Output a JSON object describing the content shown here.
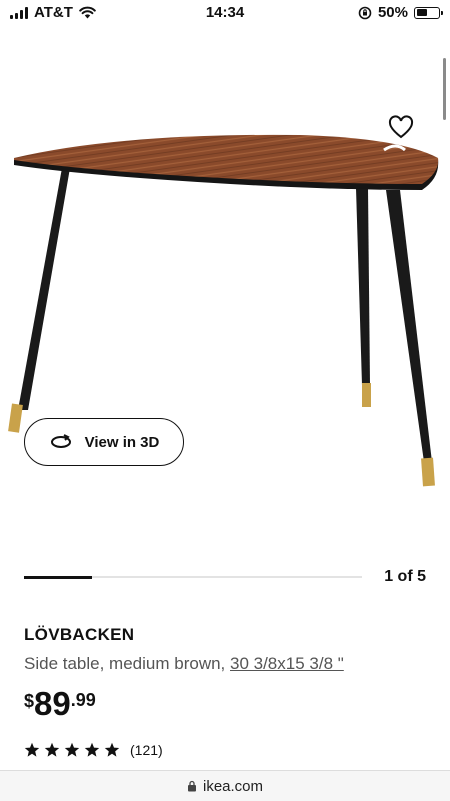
{
  "status_bar": {
    "carrier": "AT&T",
    "time": "14:34",
    "battery_percent": "50%",
    "battery_level": 0.5,
    "icons": [
      "signal-icon",
      "wifi-icon",
      "rotation-lock-icon",
      "battery-icon"
    ]
  },
  "product": {
    "favorite_icon": "heart-icon",
    "view_3d_label": "View in 3D",
    "view_3d_icon": "rotate-3d-icon",
    "carousel": {
      "counter": "1 of 5",
      "current": 1,
      "total": 5
    },
    "name": "LÖVBACKEN",
    "description": "Side table, medium brown, ",
    "dimensions": "30 3/8x15 3/8 \"",
    "price": {
      "currency": "$",
      "integer": "89",
      "decimal": ".99"
    },
    "rating": {
      "stars": 5,
      "count": "(121)"
    }
  },
  "browser": {
    "url": "ikea.com",
    "lock_icon": "lock-icon"
  },
  "colors": {
    "wood": "#8a4a2b",
    "legs": "#1a1a1a",
    "brass": "#c9a24a",
    "text": "#111111"
  }
}
